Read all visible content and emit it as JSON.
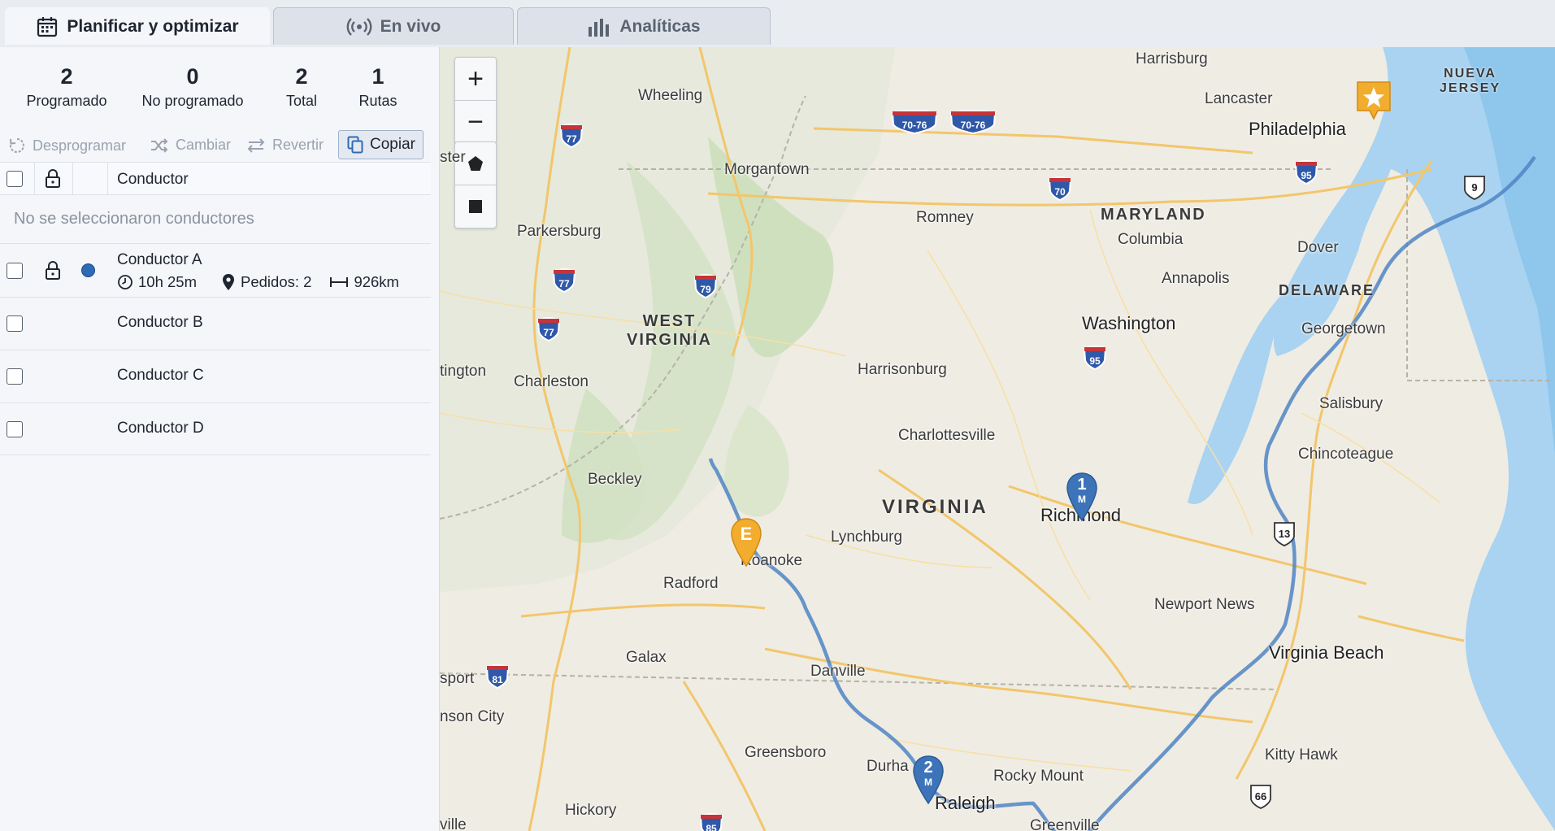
{
  "tabs": [
    {
      "label": "Planificar y optimizar",
      "active": true,
      "icon": "calendar-icon"
    },
    {
      "label": "En vivo",
      "active": false,
      "icon": "broadcast-icon"
    },
    {
      "label": "Analíticas",
      "active": false,
      "icon": "bar-chart-icon"
    }
  ],
  "stats": [
    {
      "value": "2",
      "label": "Programado"
    },
    {
      "value": "0",
      "label": "No programado"
    },
    {
      "value": "2",
      "label": "Total"
    },
    {
      "value": "1",
      "label": "Rutas"
    }
  ],
  "actions": {
    "unschedule": "Desprogramar",
    "change": "Cambiar",
    "revert": "Revertir",
    "copy": "Copiar"
  },
  "table": {
    "header": "Conductor",
    "empty_message": "No se seleccionaron conductores",
    "drivers": [
      {
        "name": "Conductor A",
        "time": "10h 25m",
        "orders": "Pedidos: 2",
        "distance": "926km",
        "color": "#2d6bb5"
      },
      {
        "name": "Conductor B"
      },
      {
        "name": "Conductor C"
      },
      {
        "name": "Conductor D"
      }
    ]
  },
  "map": {
    "zoom_in": "+",
    "zoom_out": "−",
    "markers": {
      "start": "E",
      "stop1": "1",
      "stop2": "2",
      "stop_sub": "M",
      "end_icon": "star-icon"
    },
    "states": {
      "wv1": "WEST",
      "wv2": "VIRGINIA",
      "va": "VIRGINIA",
      "md": "MARYLAND",
      "de": "DELAWARE",
      "nj1": "NUEVA",
      "nj2": "JERSEY"
    },
    "places": {
      "harrisburg": "Harrisburg",
      "lancaster": "Lancaster",
      "philadelphia": "Philadelphia",
      "wheeling": "Wheeling",
      "morgantown": "Morgantown",
      "romney": "Romney",
      "columbia": "Columbia",
      "dover": "Dover",
      "parkersburg": "Parkersburg",
      "annapolis": "Annapolis",
      "washington": "Washington",
      "georgetown": "Georgetown",
      "huntington": "tington",
      "charleston": "Charleston",
      "harrisonburg": "Harrisonburg",
      "salisbury": "Salisbury",
      "charlottesville": "Charlottesville",
      "chincoteague": "Chincoteague",
      "beckley": "Beckley",
      "richmond": "Richmond",
      "lynchburg": "Lynchburg",
      "roanoke": "Roanoke",
      "radford": "Radford",
      "newport_news": "Newport News",
      "galax": "Galax",
      "virginia_beach": "Virginia Beach",
      "danville": "Danville",
      "kingsport": "sport",
      "johnson_city": "nson City",
      "greensboro": "Greensboro",
      "durham": "Durha",
      "raleigh": "Raleigh",
      "rocky_mount": "Rocky Mount",
      "kitty_hawk": "Kitty Hawk",
      "hickory": "Hickory",
      "greenville": "Greenville",
      "rochester": "ster",
      "asheville": "ville"
    },
    "shields": {
      "i77a": "77",
      "i77b": "77",
      "i77c": "77",
      "i79": "79",
      "i70": "70",
      "i7076a": "70-76",
      "i7076b": "70-76",
      "i95a": "95",
      "i95b": "95",
      "us9": "9",
      "us13": "13",
      "i81": "81",
      "i85": "85",
      "us66": "66"
    }
  }
}
